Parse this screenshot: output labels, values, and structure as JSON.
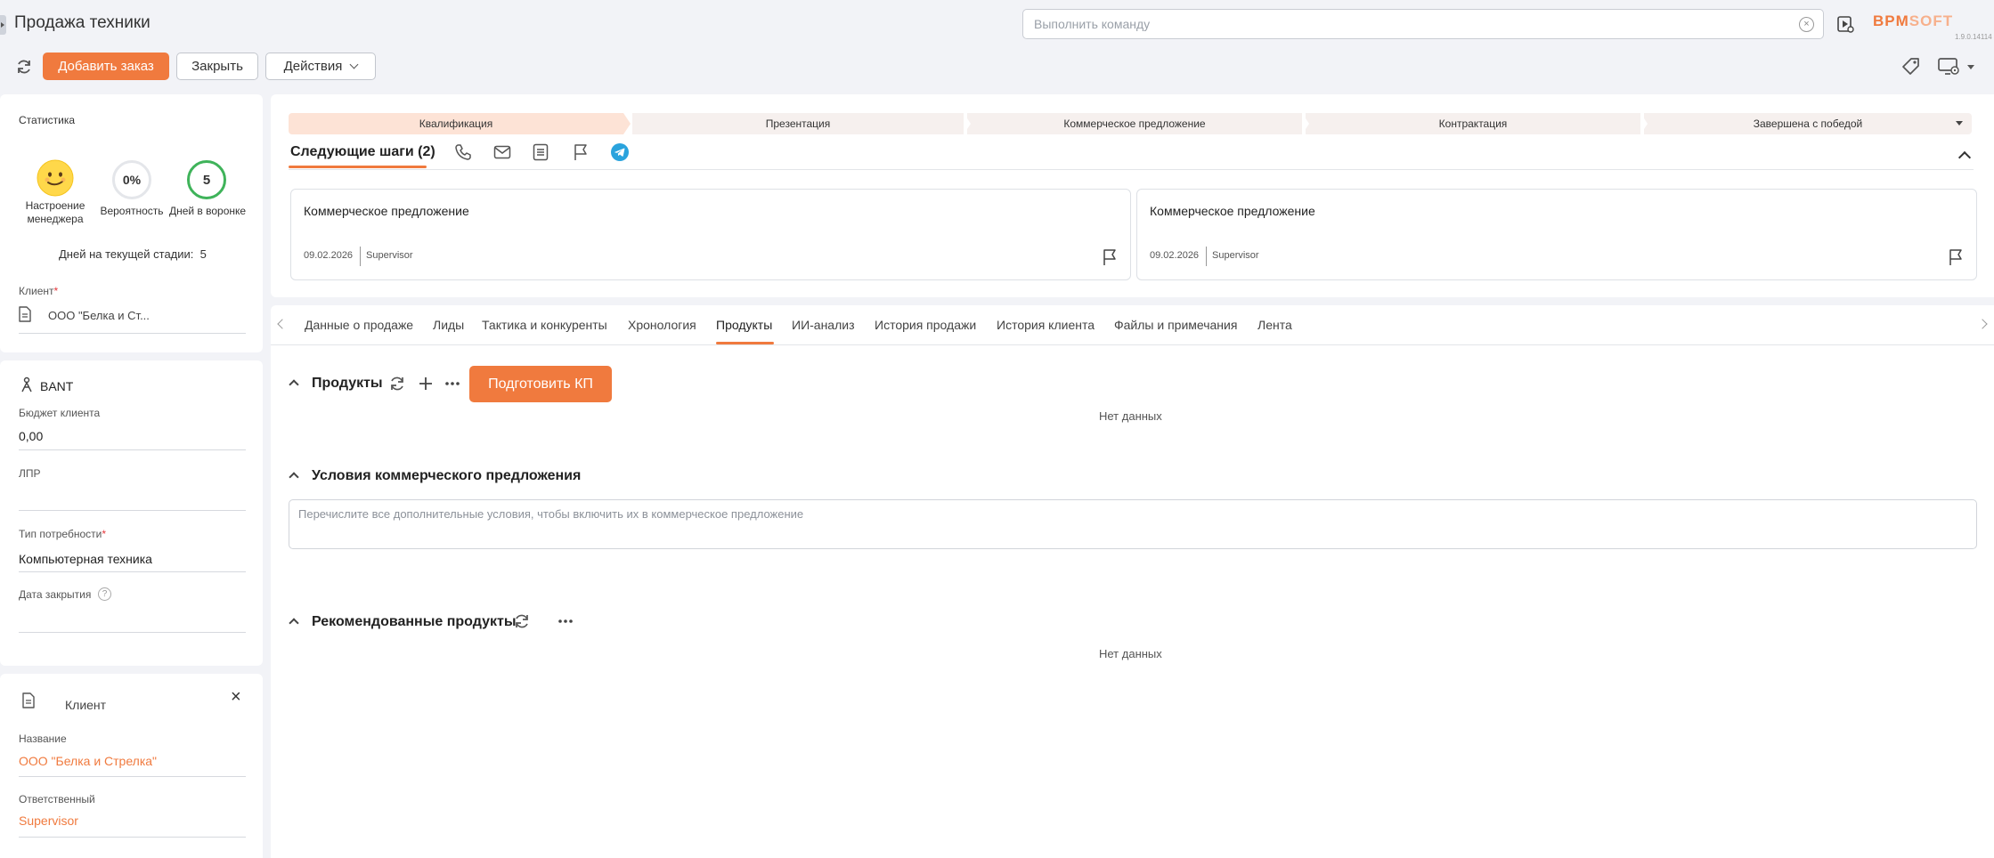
{
  "header": {
    "title": "Продажа техники",
    "command_placeholder": "Выполнить команду",
    "logo_main": "BPM",
    "logo_soft": "SOFT",
    "version": "1.9.0.14114"
  },
  "toolbar": {
    "add_order": "Добавить заказ",
    "close": "Закрыть",
    "actions": "Действия"
  },
  "stats": {
    "title": "Статистика",
    "mood_label": "Настроение менеджера",
    "probability_value": "0%",
    "probability_label": "Вероятность",
    "days_funnel_value": "5",
    "days_funnel_label": "Дней в воронке",
    "days_stage_label": "Дней на текущей стадии:",
    "days_stage_value": "5",
    "client_label": "Клиент",
    "client_value": "ООО \"Белка и Ст..."
  },
  "bant": {
    "title": "BANT",
    "budget_label": "Бюджет клиента",
    "budget_value": "0,00",
    "dm_label": "ЛПР",
    "need_label": "Тип потребности",
    "need_value": "Компьютерная техника",
    "close_date_label": "Дата закрытия"
  },
  "client_card": {
    "title": "Клиент",
    "name_label": "Название",
    "name_value": "ООО \"Белка и Стрелка\"",
    "owner_label": "Ответственный",
    "owner_value": "Supervisor"
  },
  "stages": [
    "Квалификация",
    "Презентация",
    "Коммерческое предложение",
    "Контрактация",
    "Завершена с победой"
  ],
  "next_steps": {
    "title": "Следующие шаги (2)",
    "items": [
      {
        "title": "Коммерческое предложение",
        "date": "09.02.2026",
        "owner": "Supervisor"
      },
      {
        "title": "Коммерческое предложение",
        "date": "09.02.2026",
        "owner": "Supervisor"
      }
    ]
  },
  "tabs": [
    "Данные о продаже",
    "Лиды",
    "Тактика и конкуренты",
    "Хронология",
    "Продукты",
    "ИИ-анализ",
    "История продажи",
    "История клиента",
    "Файлы и примечания",
    "Лента"
  ],
  "products": {
    "title": "Продукты",
    "prepare_button": "Подготовить КП",
    "empty": "Нет данных"
  },
  "conditions": {
    "title": "Условия коммерческого предложения",
    "placeholder": "Перечислите все дополнительные условия, чтобы включить их в коммерческое предложение"
  },
  "recommended": {
    "title": "Рекомендованные продукты",
    "empty": "Нет данных"
  },
  "colors": {
    "accent": "#f07a3e",
    "stage_active": "#fde3d6",
    "stage_inactive": "#f6f0ee",
    "funnel_ring": "#3fb35a"
  }
}
